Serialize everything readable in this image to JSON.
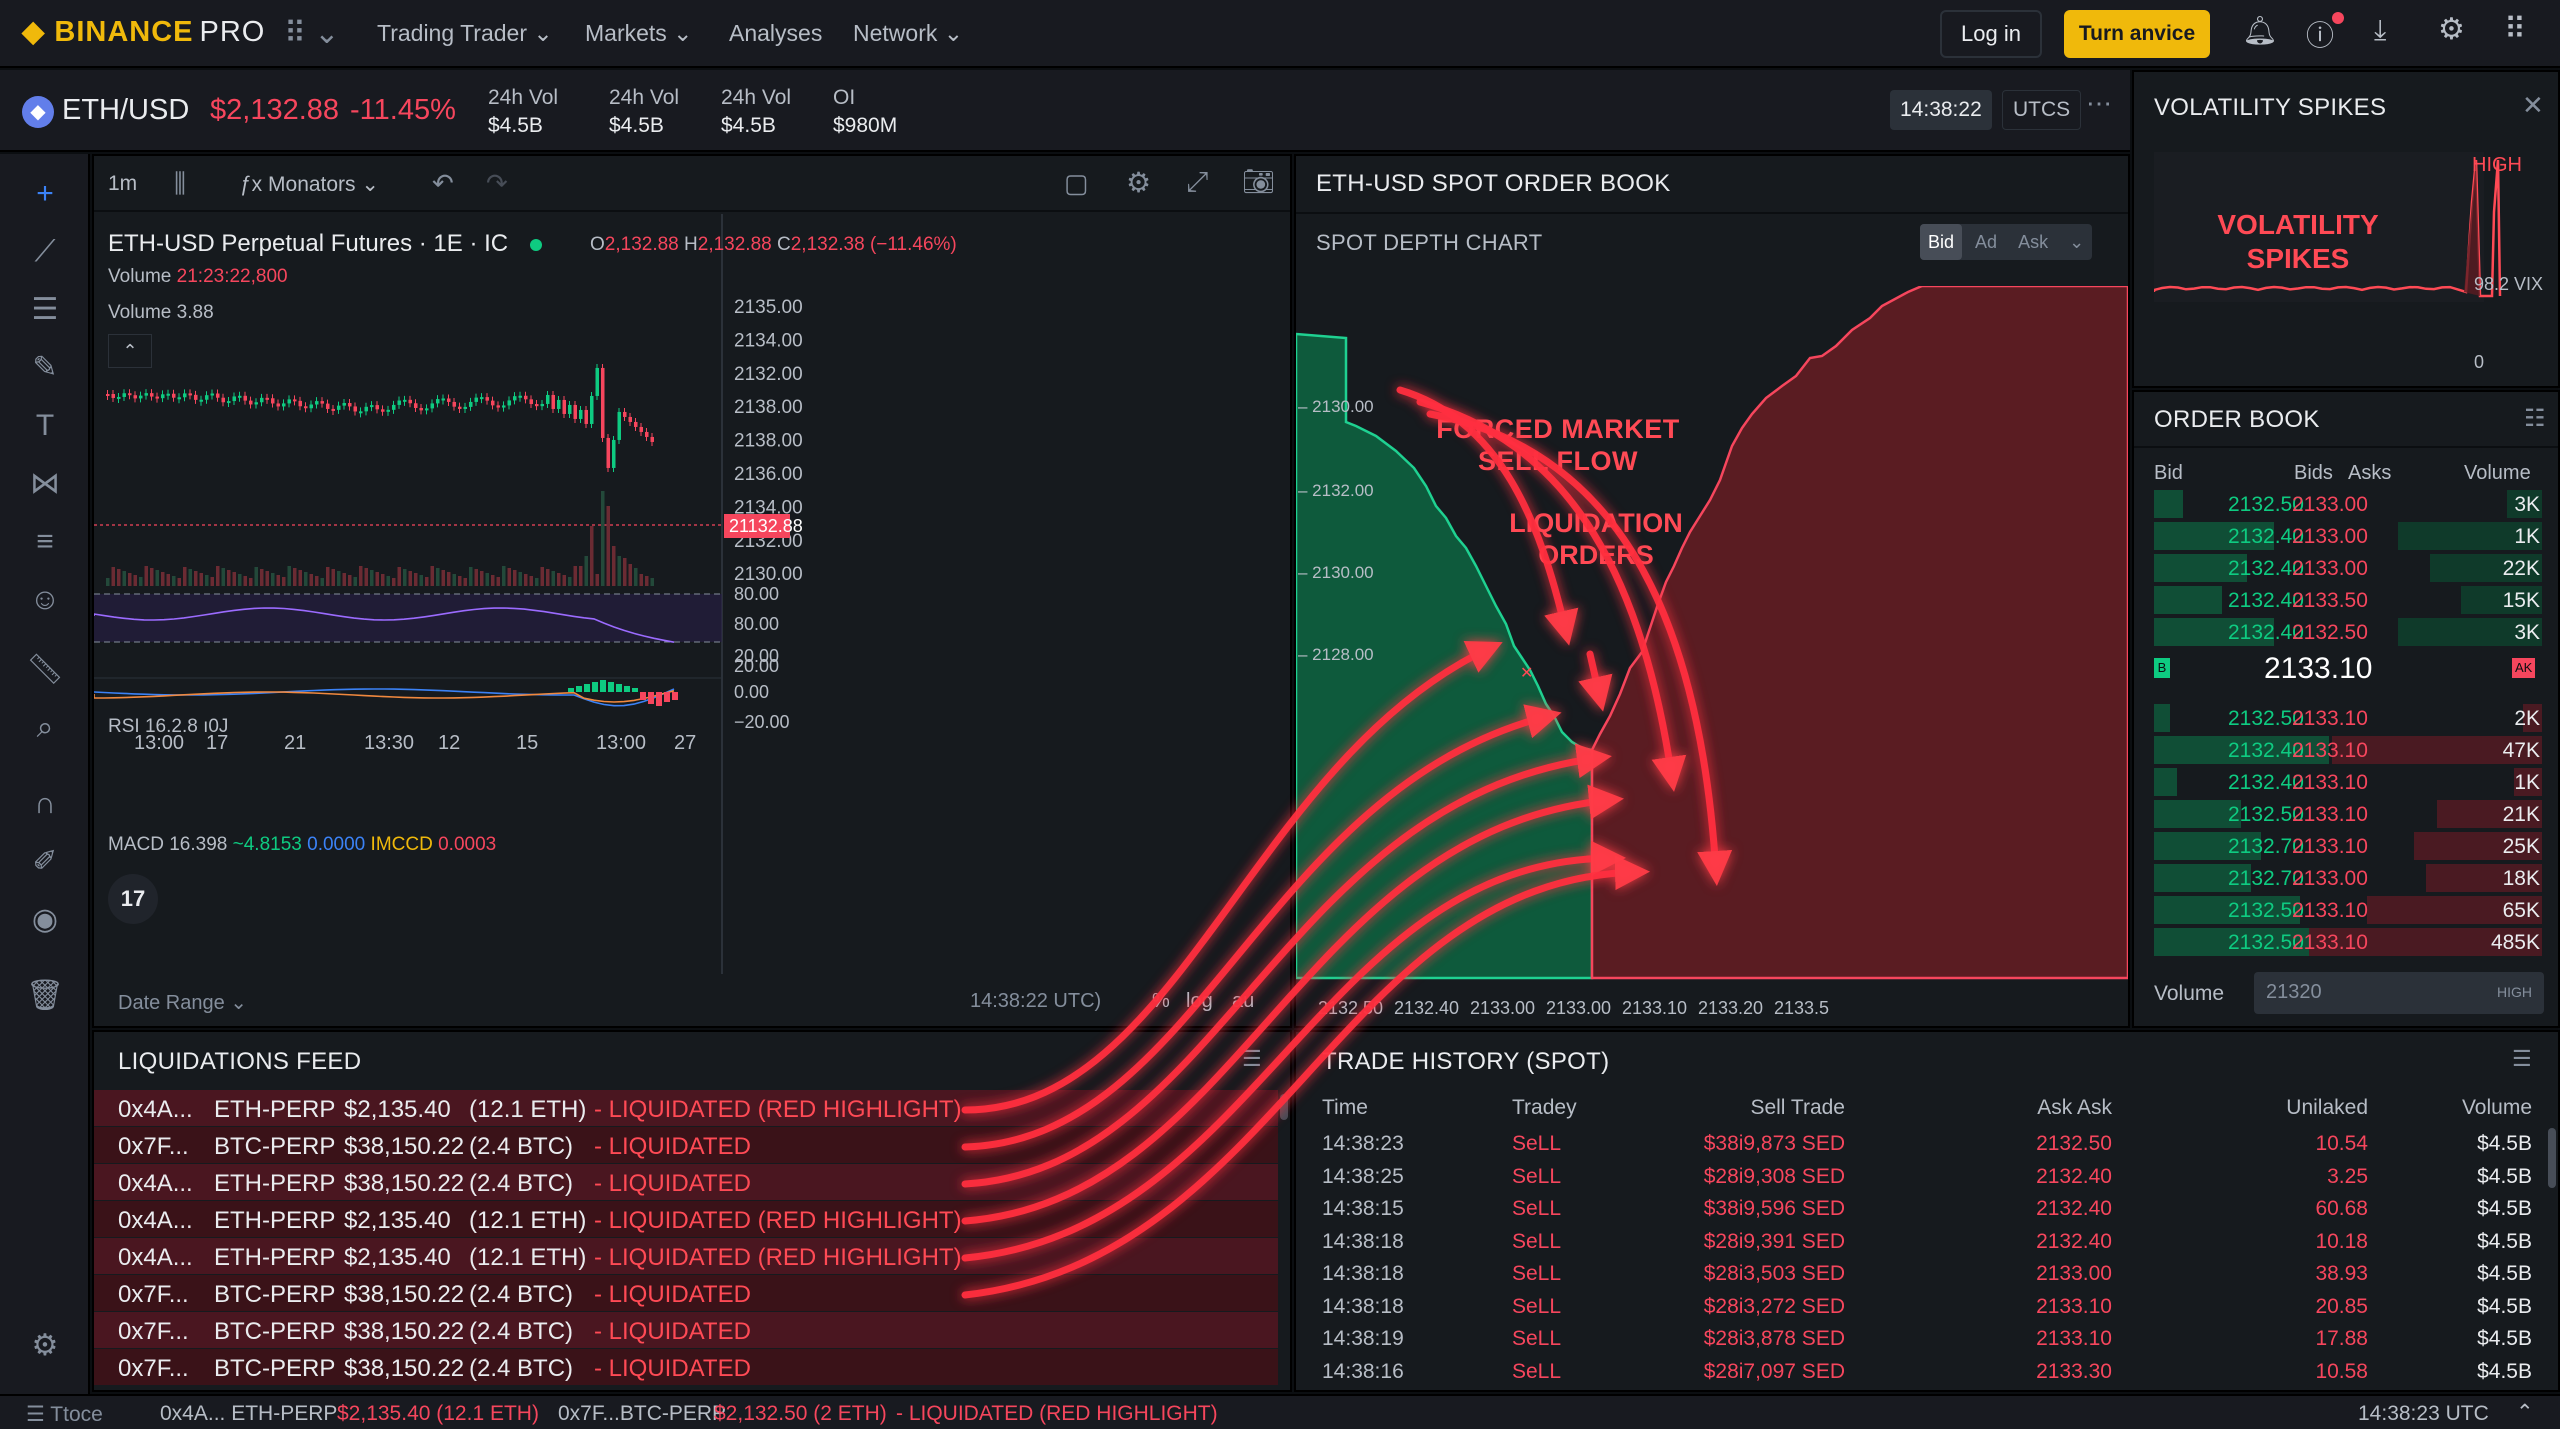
{
  "brand": {
    "name": "BINANCE",
    "suffix": "PRO"
  },
  "nav": {
    "items": [
      "Trading Trader",
      "Markets",
      "Analyses",
      "Network"
    ]
  },
  "header": {
    "login": "Log in",
    "turn": "Turn anvice"
  },
  "ticker": {
    "symbol": "ETH/USD",
    "price": "$2,132.88",
    "change": "-11.45%",
    "stats": [
      {
        "label": "24h Vol",
        "value": "$4.5B"
      },
      {
        "label": "24h Vol",
        "value": "$4.5B"
      },
      {
        "label": "24h Vol",
        "value": "$4.5B"
      },
      {
        "label": "OI",
        "value": "$980M"
      }
    ],
    "time": "14:38:22",
    "tz": "UTCS"
  },
  "chart_toolbar": {
    "interval": "1m",
    "indicators": "Monators"
  },
  "chart": {
    "title": "ETH-USD Perpetual Futures · 1E · IC",
    "ohlc": {
      "o": "2,132.88",
      "h": "2,132.88",
      "c": "2,132.38 (−11.46%)"
    },
    "volume1": {
      "label": "Volume",
      "value": "21:23:22,800"
    },
    "volume2": {
      "label": "Volume",
      "value": "3.88"
    },
    "price_label": "21132.88",
    "yticks": [
      "2135.00",
      "2134.00",
      "2132.00",
      "2138.00",
      "2138.00",
      "2136.00",
      "2134.00",
      "2132.00",
      "2130.00"
    ],
    "rsi": {
      "label": "RSI",
      "value": "16.2.8",
      "extra": "ı0J",
      "yticks": [
        "80.00",
        "80.00",
        "20.00"
      ]
    },
    "macd": {
      "label": "MACD",
      "v1": "16.398",
      "v2": "~4.8153",
      "v3": "0.0000",
      "v4": "IMCCD",
      "v5": "0.0003",
      "yticks": [
        "20.00",
        "0.00",
        "−20.00"
      ]
    },
    "xticks": [
      "13:00",
      "17",
      "21",
      "13:30",
      "12",
      "15",
      "13:00",
      "27"
    ],
    "date_range": "Date Range",
    "footer_time": "14:38:22 UTC)",
    "pct": "%",
    "log": "log",
    "auto": "au"
  },
  "depth": {
    "title": "ETH-USD SPOT ORDER BOOK",
    "subtitle": "SPOT DEPTH CHART",
    "tabs": [
      "Bid",
      "Ad",
      "Ask"
    ],
    "ylabels": [
      "2130.00",
      "2132.00",
      "2130.00",
      "2128.00"
    ],
    "xlabels": [
      "2132.50",
      "2132.40",
      "2133.00",
      "2133.00",
      "2133.10",
      "2133.20",
      "2133.5"
    ],
    "annotation1": [
      "FORCED MARKET",
      "SELL FLOW"
    ],
    "annotation2": [
      "LIQUIDATION",
      "ORDERS"
    ]
  },
  "vol": {
    "title": "VOLATILITY SPIKES",
    "big": [
      "VOLATILITY",
      "SPIKES"
    ],
    "high": "HIGH",
    "mid": "98.2 VIX",
    "zero": "0"
  },
  "orderbook": {
    "title": "ORDER BOOK",
    "cols": [
      "Bid",
      "Bids",
      "Asks",
      "Volume"
    ],
    "bids": [
      {
        "b": "2132.50",
        "a": "2133.00",
        "v": "3K",
        "d": 0.15
      },
      {
        "b": "2132.40",
        "a": "2133.00",
        "v": "1K",
        "d": 0.62
      },
      {
        "b": "2132.40",
        "a": "2133.00",
        "v": "22K",
        "d": 0.48
      },
      {
        "b": "2132.40",
        "a": "2133.50",
        "v": "15K",
        "d": 0.35
      },
      {
        "b": "2132.40",
        "a": "2132.50",
        "v": "3K",
        "d": 0.62
      }
    ],
    "mid": "2133.10",
    "mid_left": "B",
    "mid_right": "AK",
    "asks": [
      {
        "b": "2132.50",
        "a": "2133.10",
        "v": "2K",
        "d": 0.08
      },
      {
        "b": "2132.40",
        "a": "2133.10",
        "v": "47K",
        "d": 0.9
      },
      {
        "b": "2132.40",
        "a": "2133.10",
        "v": "1K",
        "d": 0.12
      },
      {
        "b": "2132.50",
        "a": "2133.10",
        "v": "21K",
        "d": 0.45
      },
      {
        "b": "2132.70",
        "a": "2133.10",
        "v": "25K",
        "d": 0.55
      },
      {
        "b": "2132.70",
        "a": "2133.00",
        "v": "18K",
        "d": 0.5
      },
      {
        "b": "2132.50",
        "a": "2133.10",
        "v": "65K",
        "d": 0.75
      },
      {
        "b": "2132.50",
        "a": "2133.10",
        "v": "485K",
        "d": 1.0
      }
    ],
    "volume_label": "Volume",
    "volume_value": "21320",
    "volume_badge": "HIGH"
  },
  "liq": {
    "title": "LIQUIDATIONS FEED",
    "rows": [
      {
        "addr": "0x4A...",
        "sym": "ETH-PERP",
        "price": "$2,135.40",
        "qty": "(12.1 ETH)",
        "status": "- LIQUIDATED (RED HIGHLIGHT)"
      },
      {
        "addr": "0x7F...",
        "sym": "BTC-PERP",
        "price": "$38,150.22",
        "qty": "(2.4 BTC)",
        "status": "- LIQUIDATED"
      },
      {
        "addr": "0x4A...",
        "sym": "ETH-PERP",
        "price": "$38,150.22",
        "qty": "(2.4 BTC)",
        "status": "- LIQUIDATED"
      },
      {
        "addr": "0x4A...",
        "sym": "ETH-PERP",
        "price": "$2,135.40",
        "qty": "(12.1 ETH)",
        "status": "- LIQUIDATED (RED HIGHLIGHT)"
      },
      {
        "addr": "0x4A...",
        "sym": "ETH-PERP",
        "price": "$2,135.40",
        "qty": "(12.1 ETH)",
        "status": "- LIQUIDATED (RED HIGHLIGHT)"
      },
      {
        "addr": "0x7F...",
        "sym": "BTC-PERP",
        "price": "$38,150.22",
        "qty": "(2.4 BTC)",
        "status": "- LIQUIDATED"
      },
      {
        "addr": "0x7F...",
        "sym": "BTC-PERP",
        "price": "$38,150.22",
        "qty": "(2.4 BTC)",
        "status": "- LIQUIDATED"
      },
      {
        "addr": "0x7F...",
        "sym": "BTC-PERP",
        "price": "$38,150.22",
        "qty": "(2.4 BTC)",
        "status": "- LIQUIDATED"
      }
    ]
  },
  "trades": {
    "title": "TRADE HISTORY (SPOT)",
    "cols": [
      "Time",
      "Tradey",
      "Sell Trade",
      "Ask Ask",
      "Unilaked",
      "Volume"
    ],
    "rows": [
      [
        "14:38:23",
        "SeLL",
        "$38i9,873 SED",
        "2132.50",
        "10.54",
        "$4.5B"
      ],
      [
        "14:38:25",
        "SeLL",
        "$28i9,308 SED",
        "2132.40",
        "3.25",
        "$4.5B"
      ],
      [
        "14:38:15",
        "SeLL",
        "$38i9,596 SED",
        "2132.40",
        "60.68",
        "$4.5B"
      ],
      [
        "14:38:18",
        "SeLL",
        "$28i9,391 SED",
        "2132.40",
        "10.18",
        "$4.5B"
      ],
      [
        "14:38:18",
        "SeLL",
        "$28i3,503 SED",
        "2133.00",
        "38.93",
        "$4.5B"
      ],
      [
        "14:38:18",
        "SeLL",
        "$28i3,272 SED",
        "2133.10",
        "20.85",
        "$4.5B"
      ],
      [
        "14:38:19",
        "SeLL",
        "$28i3,878 SED",
        "2133.10",
        "17.88",
        "$4.5B"
      ],
      [
        "14:38:16",
        "SeLL",
        "$28i7,097 SED",
        "2133.30",
        "10.58",
        "$4.5B"
      ]
    ]
  },
  "status": {
    "left": "Ttoce",
    "t1": "0x4A... ETH-PERP",
    "t2": "$2,135.40 (12.1 ETH)",
    "t3": "0x7F...BTC-PERP",
    "t4": "$2,132.50 (2 ETH)",
    "t5": "- LIQUIDATED (RED HIGHLIGHT)",
    "time": "14:38:23 UTC"
  },
  "colors": {
    "green": "#0ecb81",
    "red": "#f6465d",
    "accent": "#f0b90b",
    "glow": "#ff2d3d"
  }
}
